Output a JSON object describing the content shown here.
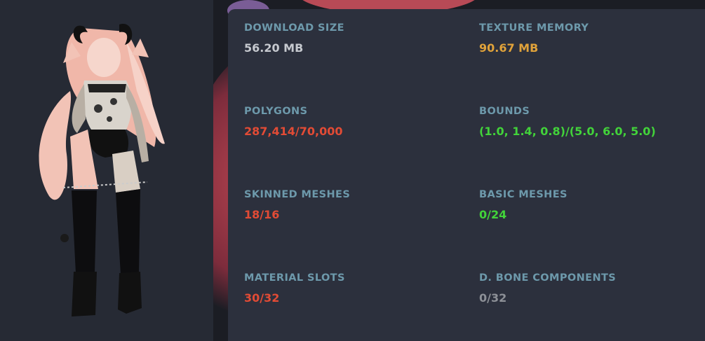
{
  "colors": {
    "label": "#6d99ab",
    "neutral": "#c6c9cf",
    "warning": "#e0a23a",
    "bad": "#e24b35",
    "good": "#42d33a",
    "muted": "#8d9097"
  },
  "stats": [
    {
      "label": "DOWNLOAD SIZE",
      "value": "56.20 MB",
      "status": "neutral"
    },
    {
      "label": "TEXTURE MEMORY",
      "value": "90.67 MB",
      "status": "warning"
    },
    {
      "label": "POLYGONS",
      "value": "287,414/70,000",
      "status": "bad"
    },
    {
      "label": "BOUNDS",
      "value": "(1.0, 1.4, 0.8)/(5.0, 6.0, 5.0)",
      "status": "good"
    },
    {
      "label": "SKINNED MESHES",
      "value": "18/16",
      "status": "bad"
    },
    {
      "label": "BASIC MESHES",
      "value": "0/24",
      "status": "good"
    },
    {
      "label": "MATERIAL SLOTS",
      "value": "30/32",
      "status": "bad"
    },
    {
      "label": "D. BONE COMPONENTS",
      "value": "0/32",
      "status": "muted"
    }
  ]
}
